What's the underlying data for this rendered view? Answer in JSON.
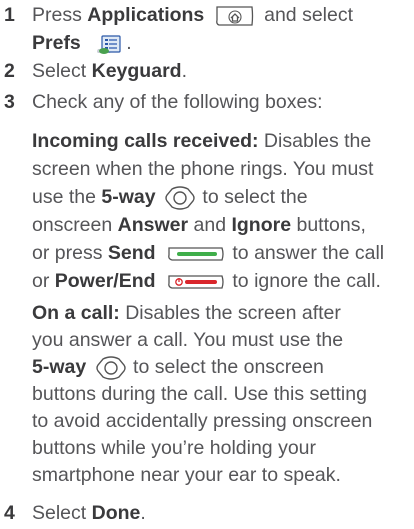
{
  "steps": [
    {
      "number": "1",
      "t1": "Press ",
      "b1": "Applications",
      "t2": " and select",
      "b2": "Prefs",
      "t3": "."
    },
    {
      "number": "2",
      "t1": "Select ",
      "b1": "Keyguard",
      "t2": "."
    },
    {
      "number": "3",
      "t1": "Check any of the following boxes:"
    },
    {
      "number": "4",
      "t1": "Select ",
      "b1": "Done",
      "t2": "."
    }
  ],
  "options": [
    {
      "title": "Incoming calls received:",
      "l1": " Disables the",
      "l2": "screen when the phone rings. You must",
      "l3a": "use the ",
      "l3b": "5-way",
      "l3c": " to select the",
      "l4a": "onscreen ",
      "l4b": "Answer",
      "l4c": " and ",
      "l4d": "Ignore",
      "l4e": " buttons,",
      "l5a": "or press ",
      "l5b": "Send",
      "l5c": " to answer the call",
      "l6a": "or ",
      "l6b": "Power/End",
      "l6c": " to ignore the call."
    },
    {
      "title": "On a call:",
      "l1": " Disables the screen after",
      "l2": "you answer a call. You must use the",
      "l3b": "5-way",
      "l3c": " to select the onscreen",
      "l4": "buttons during the call. Use this setting",
      "l5": "to avoid accidentally pressing onscreen",
      "l6": "buttons while you’re holding your",
      "l7": "smartphone near your ear to speak."
    }
  ],
  "icons": {
    "applications": "home-key-icon",
    "prefs": "prefs-app-icon",
    "five_way": "five-way-navigator-icon",
    "send": "send-key-icon",
    "power_end": "power-end-key-icon"
  },
  "colors": {
    "text": "#555558",
    "bold": "#3a3a3c",
    "send_green": "#3fae4a",
    "end_red": "#d9262c"
  }
}
